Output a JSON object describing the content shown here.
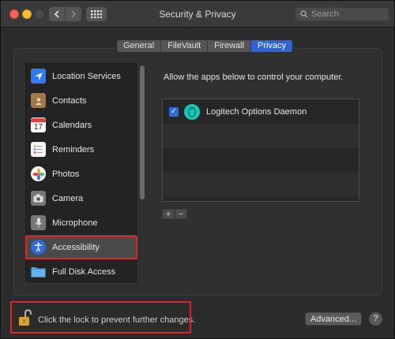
{
  "window": {
    "title": "Security & Privacy"
  },
  "toolbar": {
    "back_icon": "chevron-left-icon",
    "forward_icon": "chevron-right-icon",
    "grid_icon": "grid-icon",
    "search_placeholder": "Search"
  },
  "tabs": [
    {
      "label": "General",
      "active": false
    },
    {
      "label": "FileVault",
      "active": false
    },
    {
      "label": "Firewall",
      "active": false
    },
    {
      "label": "Privacy",
      "active": true
    }
  ],
  "sidebar": {
    "items": [
      {
        "label": "Location Services",
        "icon": "location-arrow-icon",
        "color": "#2f7bf5"
      },
      {
        "label": "Contacts",
        "icon": "contacts-book-icon",
        "color": "#a0784c"
      },
      {
        "label": "Calendars",
        "icon": "calendar-icon",
        "color": "#ffffff",
        "day": "17"
      },
      {
        "label": "Reminders",
        "icon": "reminders-list-icon",
        "color": "#f5f5f5"
      },
      {
        "label": "Photos",
        "icon": "photos-flower-icon",
        "color": "#f4a83a"
      },
      {
        "label": "Camera",
        "icon": "camera-icon",
        "color": "#777777"
      },
      {
        "label": "Microphone",
        "icon": "microphone-icon",
        "color": "#777777"
      },
      {
        "label": "Accessibility",
        "icon": "accessibility-icon",
        "color": "#2f6be0",
        "selected": true
      },
      {
        "label": "Full Disk Access",
        "icon": "folder-icon",
        "color": "#4aa0e6"
      }
    ]
  },
  "main": {
    "allow_text": "Allow the apps below to control your computer.",
    "apps": [
      {
        "name": "Logitech Options Daemon",
        "checked": true,
        "icon": "logitech-mouse-icon"
      }
    ],
    "add_label": "+",
    "remove_label": "−"
  },
  "footer": {
    "lock_text": "Click the lock to prevent further changes.",
    "advanced_label": "Advanced...",
    "help_label": "?"
  },
  "colors": {
    "accent": "#2f63d6",
    "highlight_box": "#d8252d"
  }
}
